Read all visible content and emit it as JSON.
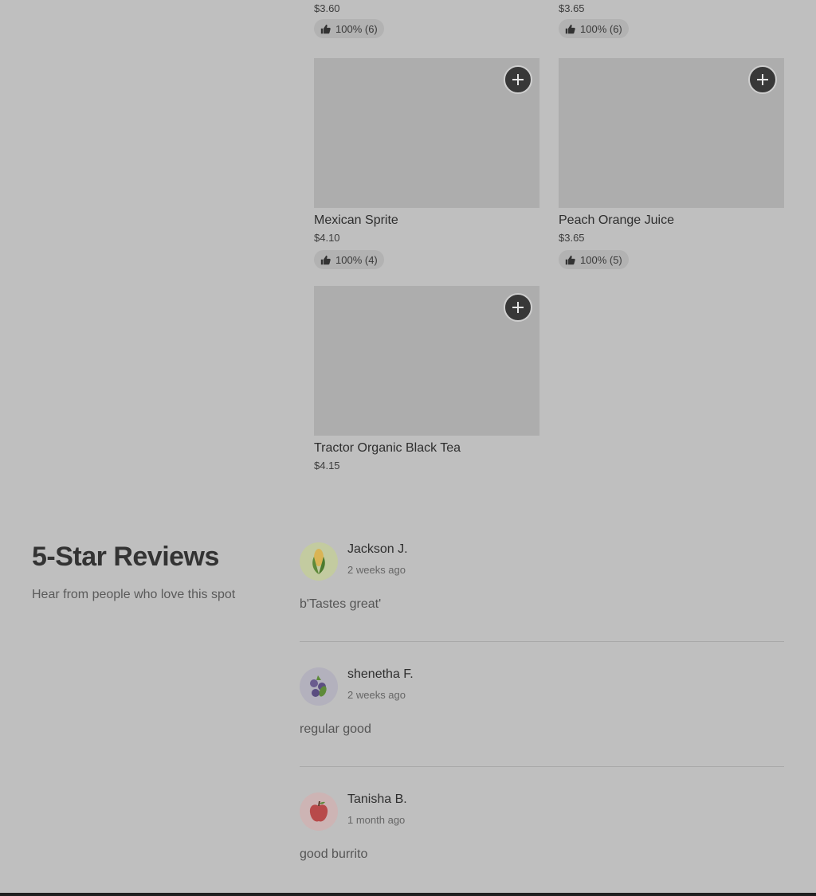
{
  "top_row": [
    {
      "price": "$3.60",
      "rating": "100% (6)"
    },
    {
      "price": "$3.65",
      "rating": "100% (6)"
    }
  ],
  "items": [
    {
      "name": "Mexican Sprite",
      "price": "$4.10",
      "rating": "100% (4)"
    },
    {
      "name": "Peach Orange Juice",
      "price": "$3.65",
      "rating": "100% (5)"
    },
    {
      "name": "Tractor Organic Black Tea",
      "price": "$4.15",
      "rating": ""
    }
  ],
  "reviews_section": {
    "title": "5-Star Reviews",
    "subtitle": "Hear from people who love this spot"
  },
  "reviews": [
    {
      "name": "Jackson J.",
      "time": "2 weeks ago",
      "text": "b'Tastes great'",
      "avatar_icon": "corn-icon"
    },
    {
      "name": "shenetha F.",
      "time": "2 weeks ago",
      "text": "regular good",
      "avatar_icon": "blueberry-icon"
    },
    {
      "name": "Tanisha B.",
      "time": "1 month ago",
      "text": "good burrito",
      "avatar_icon": "apple-icon"
    }
  ],
  "colors": {
    "overlay_bg": "#bfbfbf",
    "image_placeholder": "#adadad",
    "add_button": "#383838"
  }
}
